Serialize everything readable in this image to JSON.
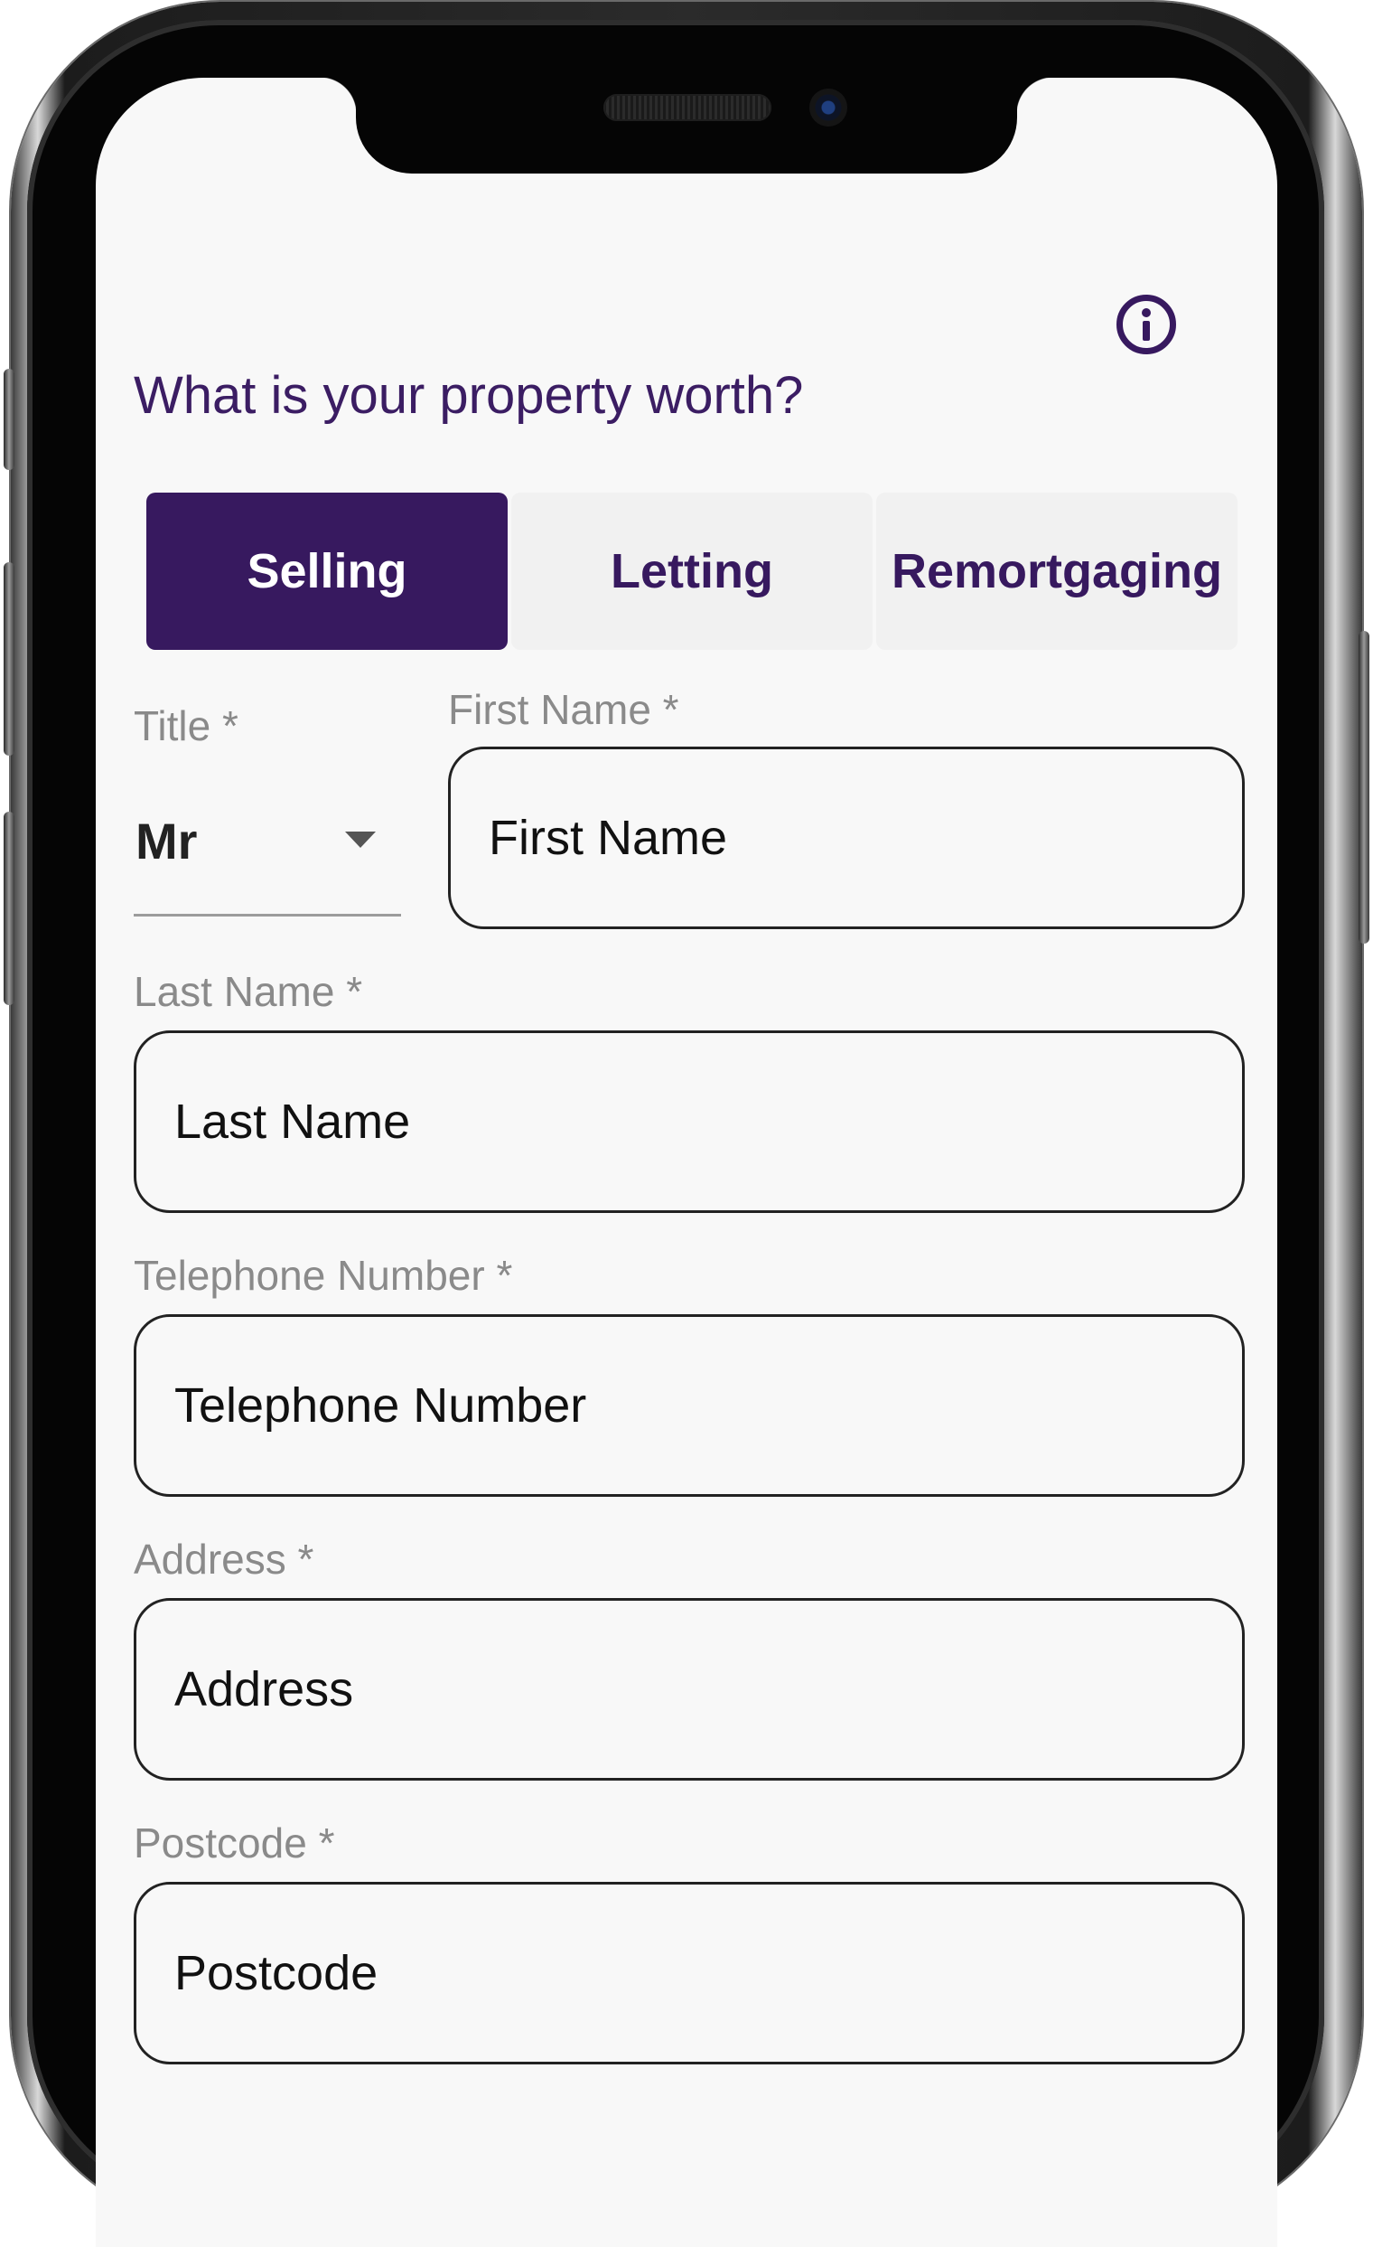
{
  "header": {
    "title": "What is your property worth?",
    "info_icon": "info-circle-icon"
  },
  "tabs": [
    {
      "label": "Selling",
      "active": true
    },
    {
      "label": "Letting",
      "active": false
    },
    {
      "label": "Remortgaging",
      "active": false
    }
  ],
  "form": {
    "title_field": {
      "label": "Title *",
      "value": "Mr"
    },
    "first_name": {
      "label": "First Name *",
      "placeholder": "First Name"
    },
    "last_name": {
      "label": "Last Name *",
      "placeholder": "Last Name"
    },
    "telephone": {
      "label": "Telephone Number *",
      "placeholder": "Telephone Number"
    },
    "address": {
      "label": "Address *",
      "placeholder": "Address"
    },
    "postcode": {
      "label": "Postcode *",
      "placeholder": "Postcode"
    }
  },
  "colors": {
    "accent": "#37195f",
    "title_text": "#3b1d63",
    "label_text": "#8a8a8a",
    "screen_background": "#f8f8f8"
  }
}
